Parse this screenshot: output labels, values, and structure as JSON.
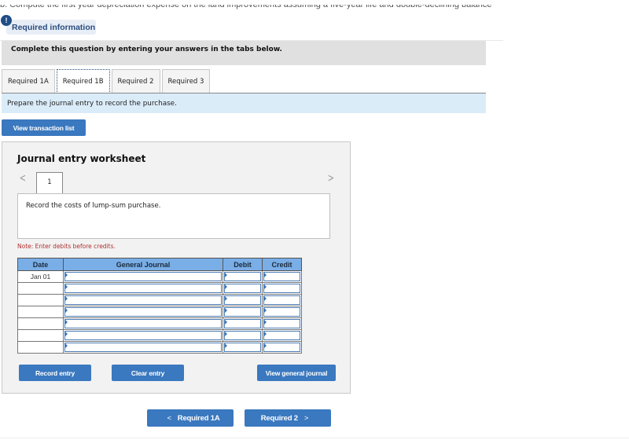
{
  "question": {
    "clipped_text": "b. Compute the first year depreciation expense on the land improvements assuming a five-year life and double-declining balance"
  },
  "required_info": {
    "icon": "alert-icon",
    "icon_glyph": "!",
    "label": "Required information"
  },
  "instructions": "Complete this question by entering your answers in the tabs below.",
  "tabs": [
    {
      "label": "Required 1A",
      "active": false
    },
    {
      "label": "Required 1B",
      "active": true
    },
    {
      "label": "Required 2",
      "active": false
    },
    {
      "label": "Required 3",
      "active": false
    }
  ],
  "prompt": "Prepare the journal entry to record the purchase.",
  "buttons": {
    "view_transaction_list": "View transaction list",
    "record_entry": "Record entry",
    "clear_entry": "Clear entry",
    "view_general_journal": "View general journal"
  },
  "worksheet": {
    "title": "Journal entry worksheet",
    "prev_icon": "chevron-left-icon",
    "prev_glyph": "<",
    "next_icon": "chevron-right-icon",
    "next_glyph": ">",
    "entry_number": "1",
    "description": "Record the costs of lump-sum purchase.",
    "note": "Note: Enter debits before credits.",
    "columns": [
      "Date",
      "General Journal",
      "Debit",
      "Credit"
    ],
    "rows": [
      {
        "date": "Jan 01",
        "account": "",
        "debit": "",
        "credit": ""
      },
      {
        "date": "",
        "account": "",
        "debit": "",
        "credit": ""
      },
      {
        "date": "",
        "account": "",
        "debit": "",
        "credit": ""
      },
      {
        "date": "",
        "account": "",
        "debit": "",
        "credit": ""
      },
      {
        "date": "",
        "account": "",
        "debit": "",
        "credit": ""
      },
      {
        "date": "",
        "account": "",
        "debit": "",
        "credit": ""
      },
      {
        "date": "",
        "account": "",
        "debit": "",
        "credit": ""
      }
    ]
  },
  "pagination": {
    "prev_label": "Required 1A",
    "prev_glyph": "<",
    "next_label": "Required 2",
    "next_glyph": ">"
  },
  "colors": {
    "button_blue": "#3a78bf",
    "header_blue": "#7aaee6",
    "prompt_bg": "#dbecf9",
    "instructions_bg": "#e0e0e0",
    "note_red": "#b03030",
    "badge_navy": "#1f4e87"
  }
}
